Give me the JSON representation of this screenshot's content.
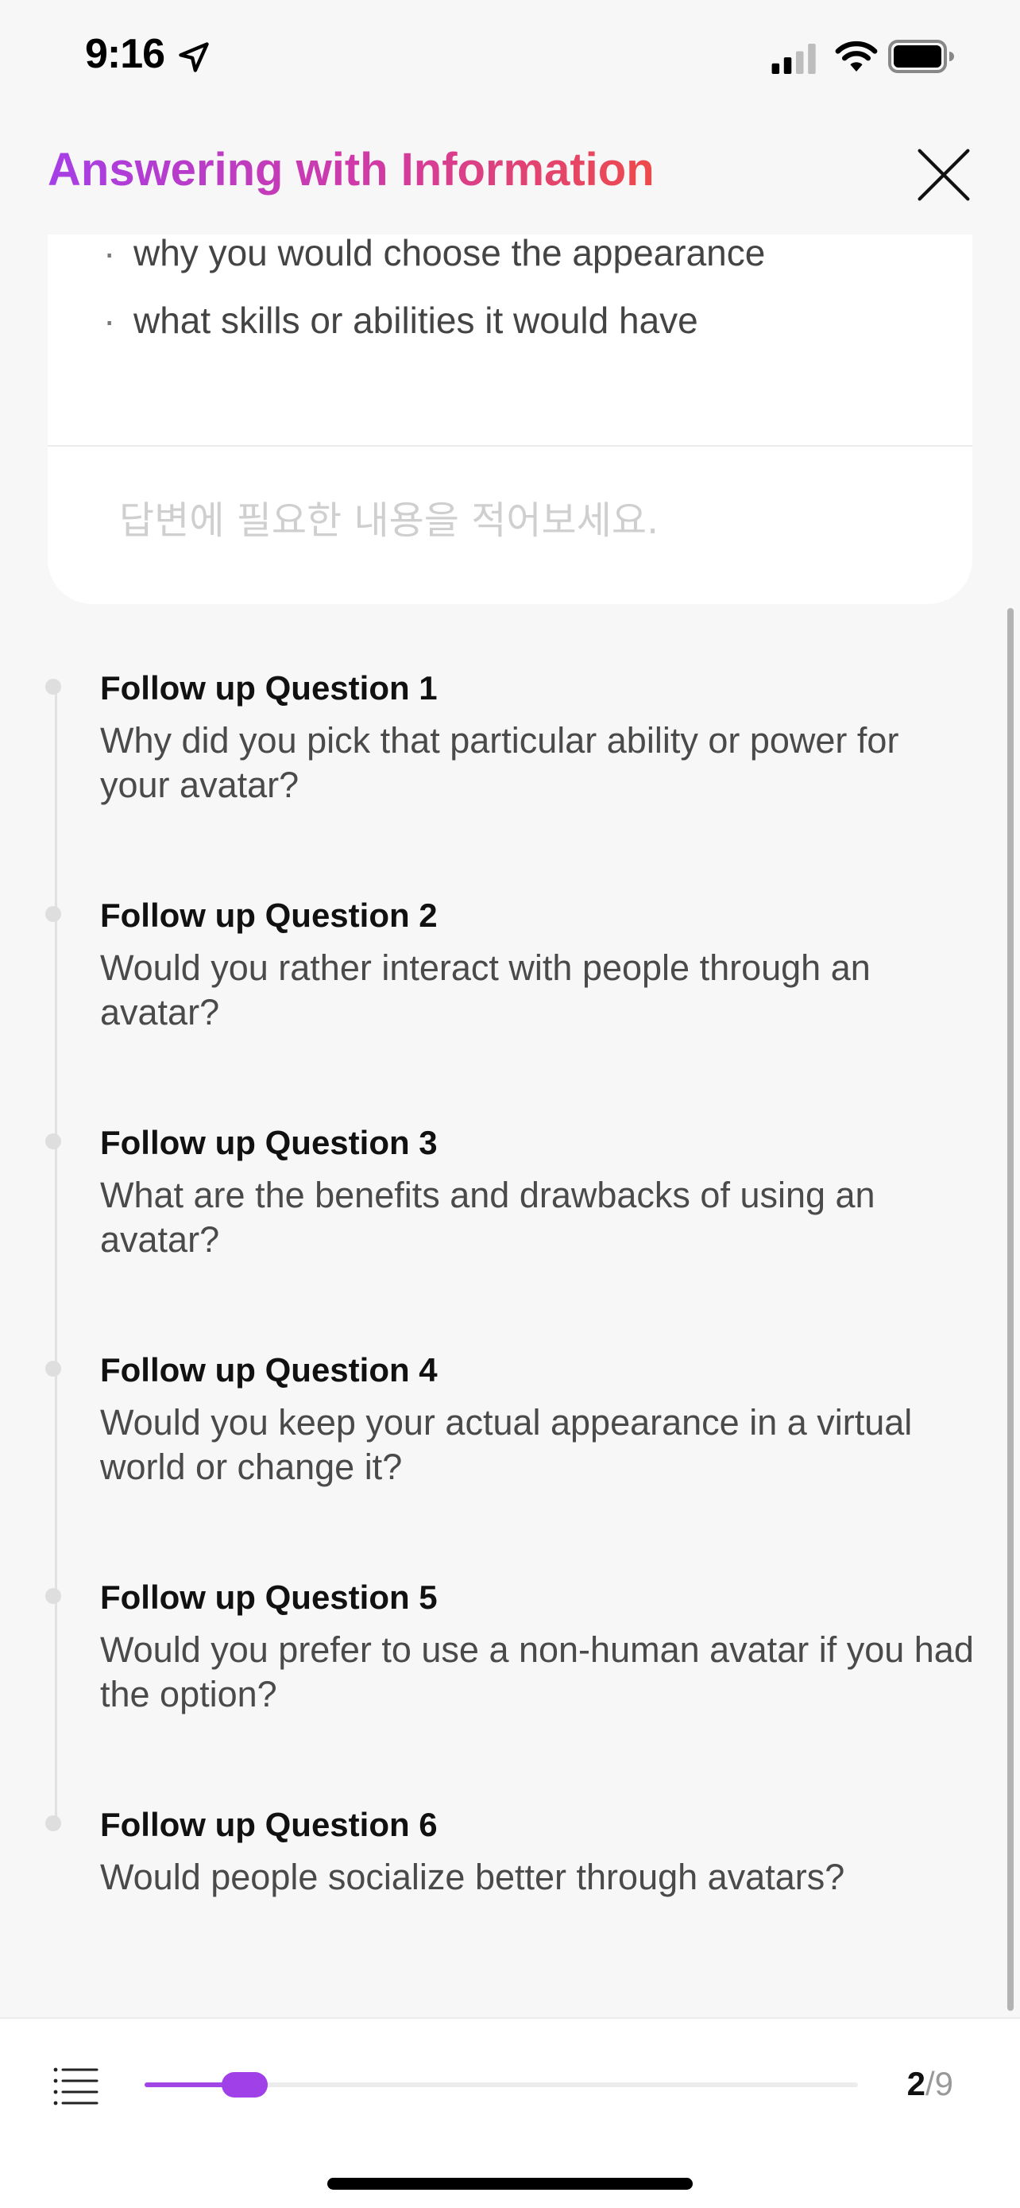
{
  "status_bar": {
    "time": "9:16"
  },
  "header": {
    "title": "Answering with Information"
  },
  "card": {
    "bullets": [
      "why you would choose the appearance",
      "what skills or abilities it would have"
    ],
    "bullet_marker": "·",
    "answer_placeholder": "답변에 필요한 내용을 적어보세요.",
    "answer_value": ""
  },
  "followups": [
    {
      "title": "Follow up Question 1",
      "text": "Why did you pick that particular ability or power for your avatar?"
    },
    {
      "title": "Follow up Question 2",
      "text": "Would you rather interact with people through an avatar?"
    },
    {
      "title": "Follow up Question 3",
      "text": "What are the benefits and drawbacks of using an avatar?"
    },
    {
      "title": "Follow up Question 4",
      "text": "Would you keep your actual appearance in a virtual world or change it?"
    },
    {
      "title": "Follow up Question 5",
      "text": "Would you prefer to use a non-human avatar if you had the option?"
    },
    {
      "title": "Follow up Question 6",
      "text": "Would people socialize better through avatars?"
    }
  ],
  "progress": {
    "current": "2",
    "separator": "/",
    "total": "9",
    "fraction": 0.14
  },
  "colors": {
    "accent": "#a040e8",
    "title_gradient_start": "#a63ee6",
    "title_gradient_end": "#ee4a4a"
  },
  "icons": {
    "location": "location-arrow-icon",
    "signal": "cellular-signal-icon",
    "wifi": "wifi-icon",
    "battery": "battery-icon",
    "close": "close-icon",
    "list": "list-icon"
  }
}
